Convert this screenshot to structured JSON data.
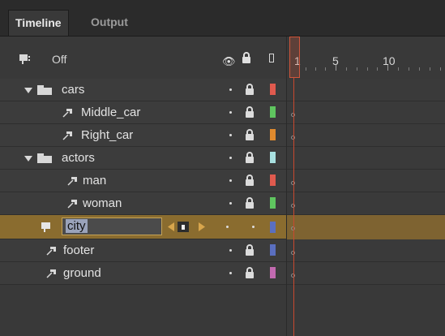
{
  "tabs": [
    {
      "label": "Timeline"
    },
    {
      "label": "Output"
    }
  ],
  "header": {
    "view_toggle": "Off",
    "ruler": [
      "1",
      "5",
      "10"
    ]
  },
  "layers": [
    {
      "name": "cars",
      "type": "folder",
      "color": "#e05a4e"
    },
    {
      "name": "Middle_car",
      "type": "guide",
      "color": "#5fc55f"
    },
    {
      "name": "Right_car",
      "type": "guide",
      "color": "#e08a2e"
    },
    {
      "name": "actors",
      "type": "folder",
      "color": "#a8e0e0"
    },
    {
      "name": "man",
      "type": "guide",
      "color": "#e05a4e"
    },
    {
      "name": "woman",
      "type": "guide",
      "color": "#5fc55f"
    },
    {
      "name": "city",
      "type": "layer",
      "color": "#5a6fc0",
      "selected": true
    },
    {
      "name": "footer",
      "type": "guide",
      "color": "#5a6fc0"
    },
    {
      "name": "ground",
      "type": "guide",
      "color": "#c26ab0"
    }
  ],
  "colors": {
    "selected_row": "#8a6c2f",
    "playhead": "#d0563b"
  }
}
